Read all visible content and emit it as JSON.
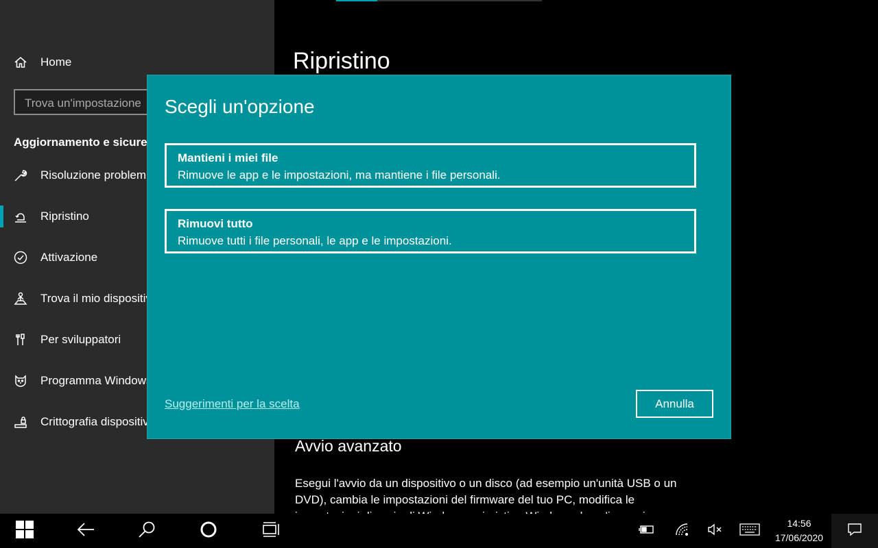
{
  "sidebar": {
    "home_label": "Home",
    "search_placeholder": "Trova un'impostazione",
    "section_title": "Aggiornamento e sicurezza",
    "items": [
      {
        "label": "Risoluzione problemi",
        "icon": "wrench-icon"
      },
      {
        "label": "Ripristino",
        "icon": "recovery-icon",
        "selected": true
      },
      {
        "label": "Attivazione",
        "icon": "check-circle-icon"
      },
      {
        "label": "Trova il mio dispositivo",
        "icon": "person-location-icon"
      },
      {
        "label": "Per sviluppatori",
        "icon": "developer-tools-icon"
      },
      {
        "label": "Programma Windows Insider",
        "icon": "insider-cat-icon"
      },
      {
        "label": "Crittografia dispositivo",
        "icon": "encryption-icon"
      }
    ]
  },
  "main": {
    "title": "Ripristino",
    "advanced": {
      "title": "Avvio avanzato",
      "text": "Esegui l'avvio da un dispositivo o un disco (ad esempio un'unità USB o un DVD), cambia le impostazioni del firmware del tuo PC, modifica le impostazioni di avvio di Windows o ripristina Windows da un'immagine"
    }
  },
  "dialog": {
    "title": "Scegli un'opzione",
    "options": [
      {
        "title": "Mantieni i miei file",
        "desc": "Rimuove le app e le impostazioni, ma mantiene i file personali."
      },
      {
        "title": "Rimuovi tutto",
        "desc": "Rimuove tutti i file personali, le app e le impostazioni."
      }
    ],
    "tips_link": "Suggerimenti per la scelta",
    "cancel_label": "Annulla"
  },
  "taskbar": {
    "time": "14:56",
    "date": "17/06/2020"
  },
  "colors": {
    "accent": "#00a3b5",
    "dialog_bg": "#00929a",
    "sidebar_bg": "#2b2b2b"
  }
}
